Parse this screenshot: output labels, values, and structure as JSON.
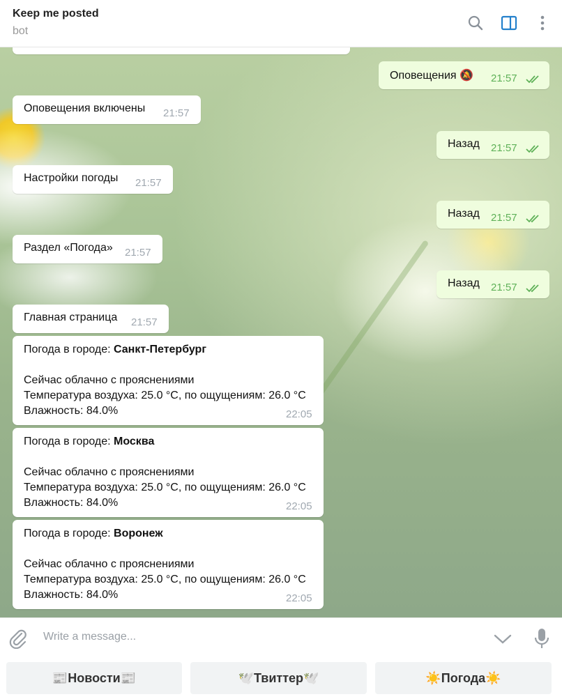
{
  "header": {
    "title": "Keep me posted",
    "status": "bot"
  },
  "messages": [
    {
      "text": "Оповещения 🔕",
      "time": "21:57",
      "dir": "out"
    },
    {
      "text": "Оповещения включены",
      "time": "21:57",
      "dir": "in"
    },
    {
      "text": "Назад",
      "time": "21:57",
      "dir": "out"
    },
    {
      "text": "Настройки погоды",
      "time": "21:57",
      "dir": "in"
    },
    {
      "text": "Назад",
      "time": "21:57",
      "dir": "out"
    },
    {
      "text": "Раздел «Погода»",
      "time": "21:57",
      "dir": "in"
    },
    {
      "text": "Назад",
      "time": "21:57",
      "dir": "out"
    },
    {
      "text": "Главная страница",
      "time": "21:57",
      "dir": "in"
    }
  ],
  "weather": [
    {
      "prefix": "Погода в городе: ",
      "city": "Санкт-Петербург",
      "line1": "Сейчас облачно с прояснениями",
      "line2": "Температура воздуха: 25.0 °C, по ощущениям: 26.0 °C",
      "line3": "Влажность: 84.0%",
      "time": "22:05"
    },
    {
      "prefix": "Погода в городе: ",
      "city": "Москва",
      "line1": "Сейчас облачно с прояснениями",
      "line2": "Температура воздуха: 25.0 °C, по ощущениям: 26.0 °C",
      "line3": "Влажность: 84.0%",
      "time": "22:05"
    },
    {
      "prefix": "Погода в городе: ",
      "city": "Воронеж",
      "line1": "Сейчас облачно с прояснениями",
      "line2": "Температура воздуха: 25.0 °C, по ощущениям: 26.0 °C",
      "line3": "Влажность: 84.0%",
      "time": "22:05"
    }
  ],
  "composer": {
    "placeholder": "Write a message..."
  },
  "keyboard": [
    {
      "label": "📰Новости📰"
    },
    {
      "label": "🕊️Твиттер🕊️"
    },
    {
      "label": "☀️Погода☀️"
    }
  ],
  "colors": {
    "outgoing_bubble": "#effdde",
    "check_color": "#5fb158",
    "accent": "#2481cc"
  }
}
